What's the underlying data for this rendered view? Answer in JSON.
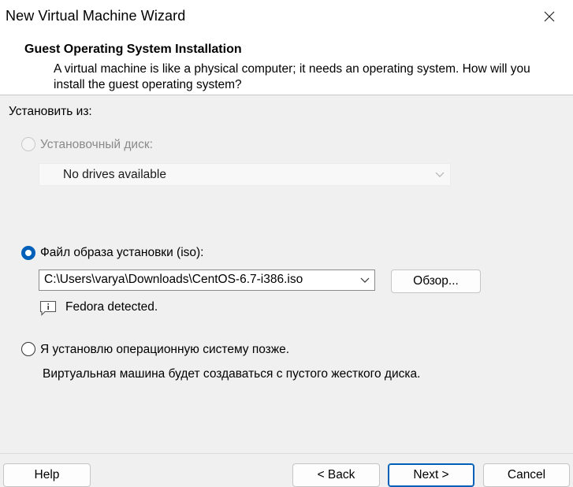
{
  "window": {
    "title": "New Virtual Machine Wizard"
  },
  "header": {
    "title": "Guest Operating System Installation",
    "description": "A virtual machine is like a physical computer; it needs an operating system. How will you install the guest operating system?"
  },
  "install_from": {
    "group_label": "Установить из:",
    "disc_option": {
      "label": "Установочный диск:",
      "enabled": false,
      "selected": false
    },
    "disc_dropdown": {
      "value": "No drives available",
      "enabled": false
    },
    "iso_option": {
      "label": "Файл образа установки (iso):",
      "enabled": true,
      "selected": true
    },
    "iso_path": {
      "value": "C:\\Users\\varya\\Downloads\\CentOS-6.7-i386.iso"
    },
    "browse_label": "Обзор...",
    "detected_text": "Fedora detected.",
    "later_option": {
      "label": "Я установлю операционную систему позже.",
      "enabled": true,
      "selected": false
    },
    "later_description": "Виртуальная машина будет создаваться с пустого жесткого диска."
  },
  "footer": {
    "help_label": "Help",
    "back_label": "< Back",
    "next_label": "Next >",
    "cancel_label": "Cancel"
  },
  "colors": {
    "accent": "#005fb8",
    "background": "#f0f0f0",
    "header_background": "#ffffff"
  },
  "icons": {
    "close": "close-icon",
    "info": "info-icon",
    "dropdown": "chevron-down-icon"
  }
}
